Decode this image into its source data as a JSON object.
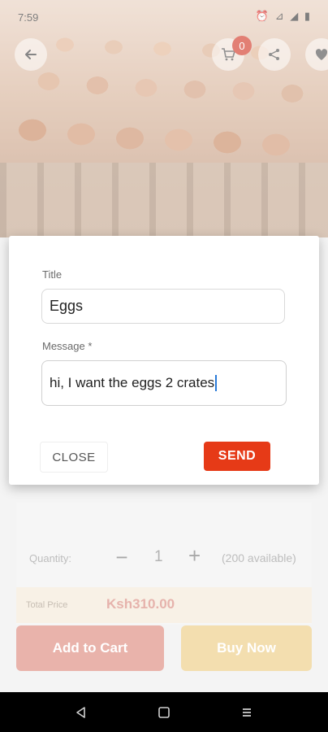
{
  "status_bar": {
    "time": "7:59",
    "icons": "⏰ ⊿ ◢ ▮"
  },
  "product": {
    "image_alt": "Eggs in trays"
  },
  "header": {
    "cart_count": "0"
  },
  "details": {
    "quantity_label": "Quantity:",
    "quantity_minus": "−",
    "quantity_value": "1",
    "quantity_plus": "+",
    "available": "(200 available)",
    "total_label": "Total Price",
    "total_value": "Ksh310.00"
  },
  "actions": {
    "add_to_cart": "Add to Cart",
    "buy_now": "Buy Now"
  },
  "dialog": {
    "title_label": "Title",
    "title_value": "Eggs",
    "message_label": "Message *",
    "message_value": "hi, I want the eggs 2 crates",
    "close_label": "CLOSE",
    "send_label": "SEND"
  },
  "colors": {
    "accent": "#e63a17",
    "buy_now": "#edcd85"
  }
}
